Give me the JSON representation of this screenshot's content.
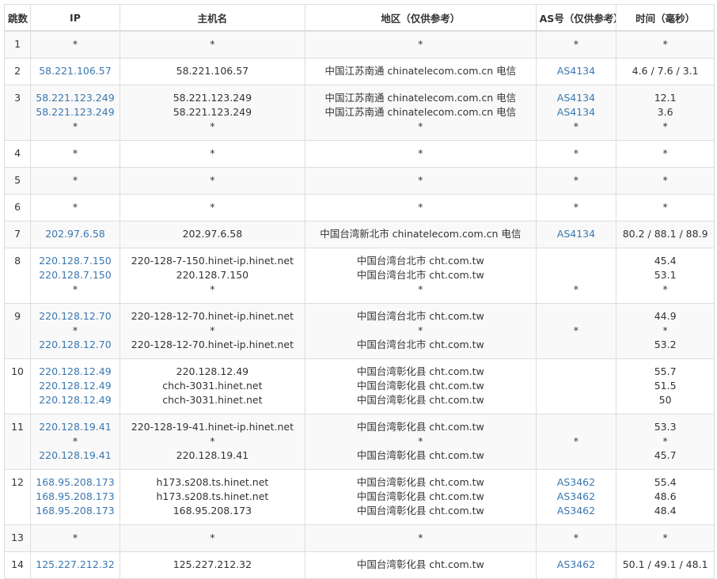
{
  "headers": [
    "跳数",
    "IP",
    "主机名",
    "地区（仅供参考）",
    "AS号（仅供参考）",
    "时间（毫秒）"
  ],
  "rows": [
    {
      "hop": "1",
      "ip": [
        "*"
      ],
      "host": [
        "*"
      ],
      "region": [
        "*"
      ],
      "as": [
        "*"
      ],
      "time": [
        "*"
      ]
    },
    {
      "hop": "2",
      "ip": [
        "58.221.106.57"
      ],
      "host": [
        "58.221.106.57"
      ],
      "region": [
        "中国江苏南通 chinatelecom.com.cn 电信"
      ],
      "as": [
        "AS4134"
      ],
      "time": [
        "4.6 / 7.6 / 3.1"
      ]
    },
    {
      "hop": "3",
      "ip": [
        "58.221.123.249",
        "58.221.123.249",
        "*"
      ],
      "host": [
        "58.221.123.249",
        "58.221.123.249",
        "*"
      ],
      "region": [
        "中国江苏南通 chinatelecom.com.cn 电信",
        "中国江苏南通 chinatelecom.com.cn 电信",
        "*"
      ],
      "as": [
        "AS4134",
        "AS4134",
        "*"
      ],
      "time": [
        "12.1",
        "3.6",
        "*"
      ]
    },
    {
      "hop": "4",
      "ip": [
        "*"
      ],
      "host": [
        "*"
      ],
      "region": [
        "*"
      ],
      "as": [
        "*"
      ],
      "time": [
        "*"
      ]
    },
    {
      "hop": "5",
      "ip": [
        "*"
      ],
      "host": [
        "*"
      ],
      "region": [
        "*"
      ],
      "as": [
        "*"
      ],
      "time": [
        "*"
      ]
    },
    {
      "hop": "6",
      "ip": [
        "*"
      ],
      "host": [
        "*"
      ],
      "region": [
        "*"
      ],
      "as": [
        "*"
      ],
      "time": [
        "*"
      ]
    },
    {
      "hop": "7",
      "ip": [
        "202.97.6.58"
      ],
      "host": [
        "202.97.6.58"
      ],
      "region": [
        "中国台湾新北市 chinatelecom.com.cn 电信"
      ],
      "as": [
        "AS4134"
      ],
      "time": [
        "80.2 / 88.1 / 88.9"
      ]
    },
    {
      "hop": "8",
      "ip": [
        "220.128.7.150",
        "220.128.7.150",
        "*"
      ],
      "host": [
        "220-128-7-150.hinet-ip.hinet.net",
        "220.128.7.150",
        "*"
      ],
      "region": [
        "中国台湾台北市 cht.com.tw",
        "中国台湾台北市 cht.com.tw",
        "*"
      ],
      "as": [
        "",
        "",
        "*"
      ],
      "time": [
        "45.4",
        "53.1",
        "*"
      ]
    },
    {
      "hop": "9",
      "ip": [
        "220.128.12.70",
        "*",
        "220.128.12.70"
      ],
      "host": [
        "220-128-12-70.hinet-ip.hinet.net",
        "*",
        "220-128-12-70.hinet-ip.hinet.net"
      ],
      "region": [
        "中国台湾台北市 cht.com.tw",
        "*",
        "中国台湾台北市 cht.com.tw"
      ],
      "as": [
        "",
        "*",
        ""
      ],
      "time": [
        "44.9",
        "*",
        "53.2"
      ]
    },
    {
      "hop": "10",
      "ip": [
        "220.128.12.49",
        "220.128.12.49",
        "220.128.12.49"
      ],
      "host": [
        "220.128.12.49",
        "chch-3031.hinet.net",
        "chch-3031.hinet.net"
      ],
      "region": [
        "中国台湾彰化县 cht.com.tw",
        "中国台湾彰化县 cht.com.tw",
        "中国台湾彰化县 cht.com.tw"
      ],
      "as": [
        "",
        "",
        ""
      ],
      "time": [
        "55.7",
        "51.5",
        "50"
      ]
    },
    {
      "hop": "11",
      "ip": [
        "220.128.19.41",
        "*",
        "220.128.19.41"
      ],
      "host": [
        "220-128-19-41.hinet-ip.hinet.net",
        "*",
        "220.128.19.41"
      ],
      "region": [
        "中国台湾彰化县 cht.com.tw",
        "*",
        "中国台湾彰化县 cht.com.tw"
      ],
      "as": [
        "",
        "*",
        ""
      ],
      "time": [
        "53.3",
        "*",
        "45.7"
      ]
    },
    {
      "hop": "12",
      "ip": [
        "168.95.208.173",
        "168.95.208.173",
        "168.95.208.173"
      ],
      "host": [
        "h173.s208.ts.hinet.net",
        "h173.s208.ts.hinet.net",
        "168.95.208.173"
      ],
      "region": [
        "中国台湾彰化县 cht.com.tw",
        "中国台湾彰化县 cht.com.tw",
        "中国台湾彰化县 cht.com.tw"
      ],
      "as": [
        "AS3462",
        "AS3462",
        "AS3462"
      ],
      "time": [
        "55.4",
        "48.6",
        "48.4"
      ]
    },
    {
      "hop": "13",
      "ip": [
        "*"
      ],
      "host": [
        "*"
      ],
      "region": [
        "*"
      ],
      "as": [
        "*"
      ],
      "time": [
        "*"
      ]
    },
    {
      "hop": "14",
      "ip": [
        "125.227.212.32"
      ],
      "host": [
        "125.227.212.32"
      ],
      "region": [
        "中国台湾彰化县 cht.com.tw"
      ],
      "as": [
        "AS3462"
      ],
      "time": [
        "50.1 / 49.1 / 48.1"
      ]
    }
  ]
}
